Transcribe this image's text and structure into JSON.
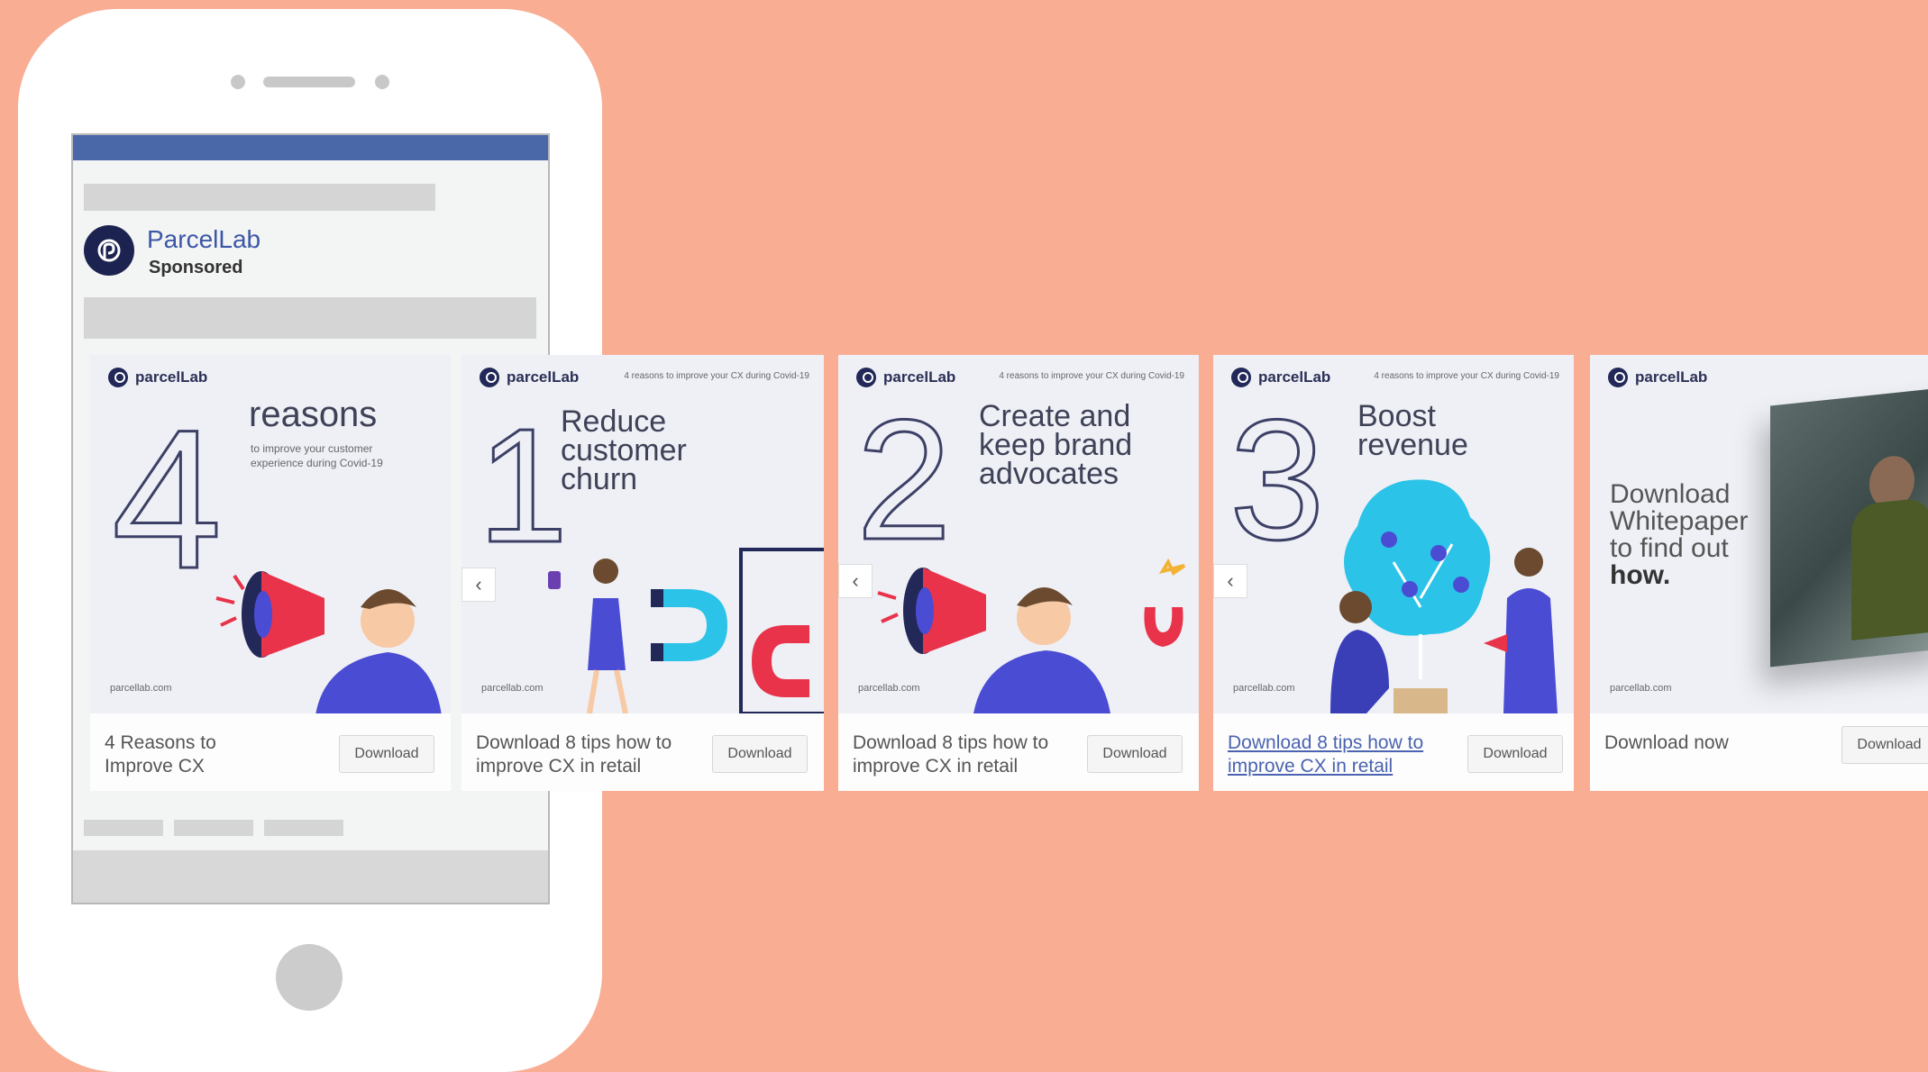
{
  "colors": {
    "background": "#f9ad93",
    "facebook_bar": "#4a67a8",
    "brand_navy": "#222857",
    "accent_red": "#e8334a",
    "accent_blue": "#4b4cd4",
    "accent_cyan": "#2cc3e8"
  },
  "feed": {
    "brand_name": "ParcelLab",
    "sponsored_label": "Sponsored"
  },
  "carousel": {
    "logo_text": "parcelLab",
    "website": "parcellab.com",
    "tagline": "4 reasons to improve your CX during Covid-19",
    "prev_arrow": "‹",
    "cards": [
      {
        "number": "4",
        "headline": "reasons",
        "subtext": "to improve your customer experience during Covid-19",
        "caption": "4 Reasons to Improve CX",
        "button": "Download",
        "illustration": "megaphone-icon"
      },
      {
        "number": "1",
        "headline": "Reduce customer churn",
        "caption": "Download 8 tips how to improve CX in retail",
        "button": "Download",
        "illustration": "magnet-icon"
      },
      {
        "number": "2",
        "headline": "Create and keep brand advocates",
        "caption": "Download 8 tips how to improve CX in retail",
        "button": "Download",
        "illustration": "megaphone-icon"
      },
      {
        "number": "3",
        "headline": "Boost revenue",
        "caption": "Download 8 tips how to improve CX in retail",
        "button": "Download",
        "illustration": "money-tree-icon"
      },
      {
        "headline_line1": "Download",
        "headline_line2": "Whitepaper",
        "headline_line3": "to find out",
        "headline_bold": "how.",
        "caption": "Download now",
        "button": "Download",
        "illustration": "warehouse-photo"
      }
    ]
  }
}
